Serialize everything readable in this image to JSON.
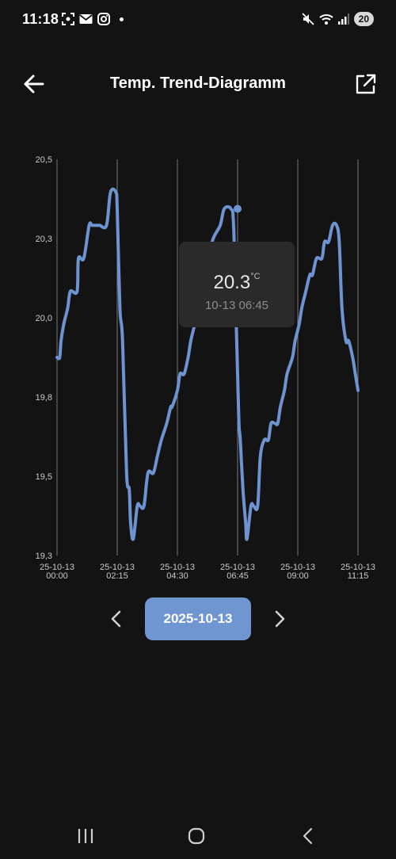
{
  "status": {
    "time": "11:18",
    "battery": "20",
    "left_icons": [
      "screenshot-icon",
      "mail-icon",
      "instagram-icon"
    ],
    "right_icons": [
      "mute-icon",
      "wifi-icon",
      "signal-icon"
    ]
  },
  "header": {
    "title": "Temp. Trend-Diagramm",
    "back_icon": "arrow-left-icon",
    "share_icon": "open-external-icon"
  },
  "chart_data": {
    "type": "line",
    "title": "",
    "xlabel": "",
    "ylabel": "",
    "ylim": [
      19.3,
      20.5
    ],
    "y_ticks": [
      "20,5",
      "20,3",
      "20,0",
      "19,8",
      "19,5",
      "19,3"
    ],
    "x_ticks": [
      {
        "date": "25-10-13",
        "time": "00:00"
      },
      {
        "date": "25-10-13",
        "time": "02:15"
      },
      {
        "date": "25-10-13",
        "time": "04:30"
      },
      {
        "date": "25-10-13",
        "time": "06:45"
      },
      {
        "date": "25-10-13",
        "time": "09:00"
      },
      {
        "date": "25-10-13",
        "time": "11:15"
      }
    ],
    "grid": "vertical",
    "line_color": "#6d93d0",
    "series": [
      {
        "x_hours": [
          0.0,
          0.1,
          0.15,
          0.25,
          0.4,
          0.5,
          0.75,
          0.8,
          1.0,
          1.2,
          1.3,
          1.4,
          1.55,
          1.6,
          1.85,
          2.0,
          2.2,
          2.25,
          2.35,
          2.45,
          2.6,
          2.7,
          2.75,
          2.85,
          3.0,
          3.1,
          3.25,
          3.4,
          3.6,
          3.75,
          3.9,
          4.1,
          4.25,
          4.3,
          4.5,
          4.6,
          4.75,
          4.9,
          5.0,
          5.15,
          5.3,
          5.5,
          5.65,
          5.8,
          6.1,
          6.25,
          6.5,
          6.6,
          6.7,
          6.75,
          6.8,
          6.85,
          6.95,
          7.05,
          7.1,
          7.25,
          7.35,
          7.5,
          7.6,
          7.75,
          7.9,
          8.0,
          8.15,
          8.25,
          8.35,
          8.5,
          8.6,
          8.8,
          8.9,
          9.05,
          9.15,
          9.3,
          9.45,
          9.55,
          9.7,
          9.9,
          10.0,
          10.15,
          10.3,
          10.45,
          10.55,
          10.65,
          10.8,
          10.9,
          11.05,
          11.15,
          11.25
        ],
        "y": [
          19.9,
          19.9,
          19.95,
          20.0,
          20.05,
          20.1,
          20.1,
          20.2,
          20.2,
          20.3,
          20.3,
          20.3,
          20.3,
          20.3,
          20.3,
          20.4,
          20.4,
          20.35,
          20.05,
          19.95,
          19.55,
          19.5,
          19.4,
          19.35,
          19.45,
          19.45,
          19.45,
          19.55,
          19.55,
          19.6,
          19.65,
          19.7,
          19.75,
          19.75,
          19.8,
          19.85,
          19.85,
          19.9,
          19.95,
          20.0,
          20.05,
          20.1,
          20.15,
          20.25,
          20.3,
          20.35,
          20.35,
          20.3,
          20.0,
          19.85,
          19.7,
          19.65,
          19.5,
          19.4,
          19.35,
          19.45,
          19.45,
          19.45,
          19.6,
          19.65,
          19.65,
          19.7,
          19.7,
          19.7,
          19.75,
          19.8,
          19.85,
          19.9,
          19.95,
          20.0,
          20.05,
          20.1,
          20.15,
          20.15,
          20.2,
          20.2,
          20.25,
          20.25,
          20.3,
          20.3,
          20.25,
          20.05,
          19.95,
          19.95,
          19.9,
          19.85,
          19.8
        ]
      }
    ],
    "tooltip": {
      "value": "20.3",
      "unit": "°C",
      "time": "10-13 06:45",
      "x_hour": 6.75,
      "y": 20.35
    }
  },
  "date_nav": {
    "date": "2025-10-13",
    "prev_icon": "chevron-left-icon",
    "next_icon": "chevron-right-icon"
  },
  "nav_bar": {
    "items": [
      "recent-apps-icon",
      "home-icon",
      "back-nav-icon"
    ]
  }
}
